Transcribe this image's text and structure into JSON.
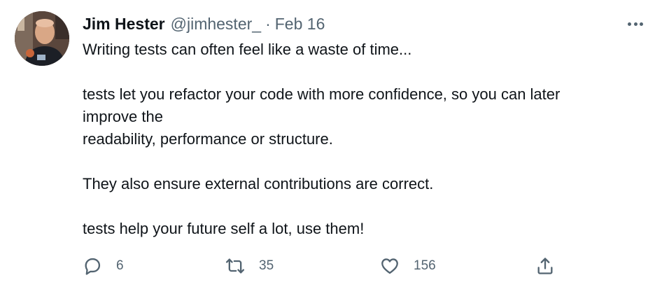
{
  "author": {
    "name": "Jim Hester",
    "handle": "@jimhester_",
    "separator": "·",
    "date": "Feb 16"
  },
  "tweet": {
    "paragraphs": [
      [
        "Writing tests can often feel like a waste of time..."
      ],
      [
        "tests let you refactor your code with more confidence, so you can later",
        "improve the",
        "readability, performance or structure."
      ],
      [
        "They also ensure external contributions are correct."
      ],
      [
        "tests help your future self a lot, use them!"
      ]
    ]
  },
  "actions": {
    "reply_count": "6",
    "retweet_count": "35",
    "like_count": "156"
  },
  "icons": {
    "more": "more-options-icon",
    "reply": "reply-icon",
    "retweet": "retweet-icon",
    "like": "heart-icon",
    "share": "share-icon"
  },
  "colors": {
    "text": "#0f1419",
    "secondary": "#536471"
  }
}
